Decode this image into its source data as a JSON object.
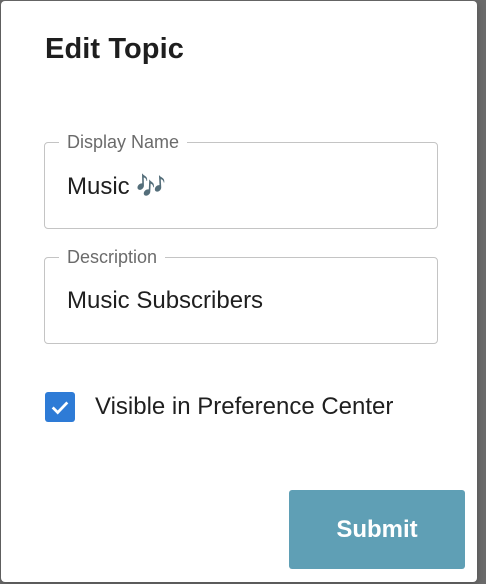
{
  "dialog": {
    "title": "Edit Topic"
  },
  "fields": {
    "display_name": {
      "label": "Display Name",
      "value": "Music 🎶"
    },
    "description": {
      "label": "Description",
      "value": "Music Subscribers"
    }
  },
  "visibility": {
    "label": "Visible in Preference Center",
    "checked": true,
    "icon": "checkmark-icon"
  },
  "actions": {
    "submit_label": "Submit"
  },
  "colors": {
    "backdrop": "#6b6b6b",
    "checkbox": "#2e7bd6",
    "submit_button": "#5f9fb5"
  }
}
